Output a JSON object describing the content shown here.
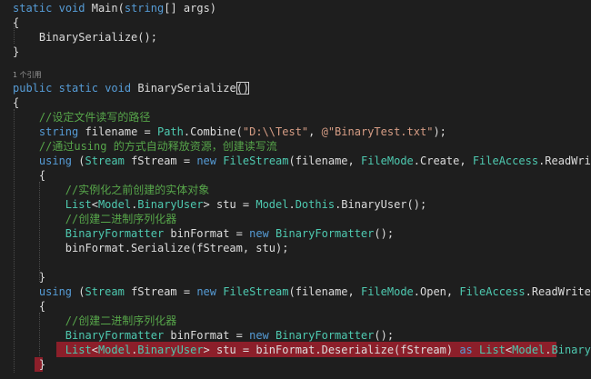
{
  "editor": {
    "codelens": "1 个引用",
    "lines": [
      [
        [
          "kw",
          "static"
        ],
        [
          "tx",
          " "
        ],
        [
          "kw",
          "void"
        ],
        [
          "tx",
          " Main("
        ],
        [
          "kw",
          "string"
        ],
        [
          "tx",
          "[] args)"
        ]
      ],
      [
        [
          "tx",
          "{"
        ]
      ],
      [
        [
          "tx",
          "    BinarySerialize();"
        ]
      ],
      [
        [
          "tx",
          "}"
        ]
      ],
      [
        [
          "kw",
          "public"
        ],
        [
          "tx",
          " "
        ],
        [
          "kw",
          "static"
        ],
        [
          "tx",
          " "
        ],
        [
          "kw",
          "void"
        ],
        [
          "tx",
          " BinarySerialize"
        ],
        [
          "box",
          "()"
        ]
      ],
      [
        [
          "tx",
          "{"
        ]
      ],
      [
        [
          "tx",
          "    "
        ],
        [
          "cm",
          "//设定文件读写的路径"
        ]
      ],
      [
        [
          "tx",
          "    "
        ],
        [
          "kw",
          "string"
        ],
        [
          "tx",
          " filename = "
        ],
        [
          "ty",
          "Path"
        ],
        [
          "tx",
          ".Combine("
        ],
        [
          "st",
          "\"D:\\\\Test\""
        ],
        [
          "tx",
          ", "
        ],
        [
          "st",
          "@\"BinaryTest.txt\""
        ],
        [
          "tx",
          ");"
        ]
      ],
      [
        [
          "tx",
          "    "
        ],
        [
          "cm",
          "//通过using 的方式自动释放资源，创建读写流"
        ]
      ],
      [
        [
          "tx",
          "    "
        ],
        [
          "kw",
          "using"
        ],
        [
          "tx",
          " ("
        ],
        [
          "ty",
          "Stream"
        ],
        [
          "tx",
          " fStream = "
        ],
        [
          "kw",
          "new"
        ],
        [
          "tx",
          " "
        ],
        [
          "ty",
          "FileStream"
        ],
        [
          "tx",
          "(filename, "
        ],
        [
          "ty",
          "FileMode"
        ],
        [
          "tx",
          ".Create, "
        ],
        [
          "ty",
          "FileAccess"
        ],
        [
          "tx",
          ".ReadWrite))"
        ]
      ],
      [
        [
          "tx",
          "    {"
        ]
      ],
      [
        [
          "tx",
          "        "
        ],
        [
          "cm",
          "//实例化之前创建的实体对象"
        ]
      ],
      [
        [
          "tx",
          "        "
        ],
        [
          "ty",
          "List"
        ],
        [
          "tx",
          "<"
        ],
        [
          "ty",
          "Model"
        ],
        [
          "tx",
          "."
        ],
        [
          "ty",
          "BinaryUser"
        ],
        [
          "tx",
          "> stu = "
        ],
        [
          "ty",
          "Model"
        ],
        [
          "tx",
          "."
        ],
        [
          "ty",
          "Dothis"
        ],
        [
          "tx",
          ".BinaryUser();"
        ]
      ],
      [
        [
          "tx",
          "        "
        ],
        [
          "cm",
          "//创建二进制序列化器"
        ]
      ],
      [
        [
          "tx",
          "        "
        ],
        [
          "ty",
          "BinaryFormatter"
        ],
        [
          "tx",
          " binFormat = "
        ],
        [
          "kw",
          "new"
        ],
        [
          "tx",
          " "
        ],
        [
          "ty",
          "BinaryFormatter"
        ],
        [
          "tx",
          "();"
        ]
      ],
      [
        [
          "tx",
          "        binFormat.Serialize(fStream, stu);"
        ]
      ],
      [
        [
          "tx",
          ""
        ]
      ],
      [
        [
          "tx",
          "    }"
        ]
      ],
      [
        [
          "tx",
          "    "
        ],
        [
          "kw",
          "using"
        ],
        [
          "tx",
          " ("
        ],
        [
          "ty",
          "Stream"
        ],
        [
          "tx",
          " fStream = "
        ],
        [
          "kw",
          "new"
        ],
        [
          "tx",
          " "
        ],
        [
          "ty",
          "FileStream"
        ],
        [
          "tx",
          "(filename, "
        ],
        [
          "ty",
          "FileMode"
        ],
        [
          "tx",
          ".Open, "
        ],
        [
          "ty",
          "FileAccess"
        ],
        [
          "tx",
          ".ReadWrite))"
        ]
      ],
      [
        [
          "tx",
          "    {"
        ]
      ],
      [
        [
          "tx",
          "        "
        ],
        [
          "cm",
          "//创建二进制序列化器"
        ]
      ],
      [
        [
          "tx",
          "        "
        ],
        [
          "ty",
          "BinaryFormatter"
        ],
        [
          "tx",
          " binFormat = "
        ],
        [
          "kw",
          "new"
        ],
        [
          "tx",
          " "
        ],
        [
          "ty",
          "BinaryFormatter"
        ],
        [
          "tx",
          "();"
        ]
      ],
      [
        [
          "tx",
          "        "
        ],
        [
          "ty",
          "List"
        ],
        [
          "tx",
          "<"
        ],
        [
          "ty",
          "Model"
        ],
        [
          "tx",
          "."
        ],
        [
          "ty",
          "BinaryUser"
        ],
        [
          "tx",
          "> stu = binFormat.Deserialize(fStream) "
        ],
        [
          "kw",
          "as"
        ],
        [
          "tx",
          " "
        ],
        [
          "ty",
          "List"
        ],
        [
          "tx",
          "<"
        ],
        [
          "ty",
          "Model"
        ],
        [
          "tx",
          "."
        ],
        [
          "ty",
          "BinaryUser"
        ],
        [
          "tx",
          ">;"
        ]
      ],
      [
        [
          "tx",
          "    }"
        ]
      ]
    ]
  }
}
